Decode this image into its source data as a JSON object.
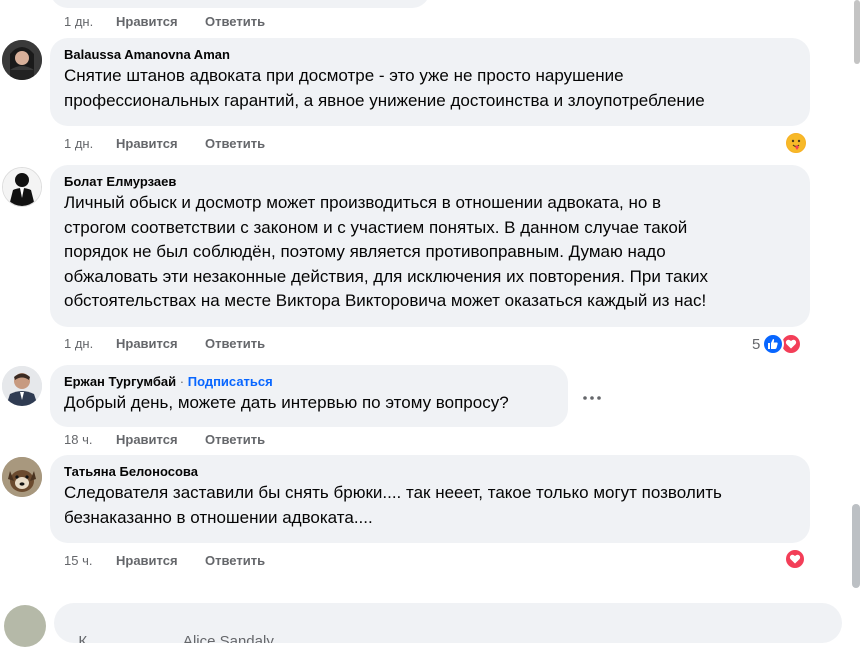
{
  "comments": [
    {
      "author": "Balaussa Amanovna Aman",
      "text": "Снятие штанов адвоката при досмотре - это уже не просто нарушение\nпрофессиональных гарантий, а явное унижение достоинства и злоупотребление",
      "time": "1 дн.",
      "like_label": "Нравится",
      "reply_label": "Ответить",
      "reaction_icons": [
        "care-emoji-icon"
      ]
    },
    {
      "author": "Болат Елмурзаев",
      "text": "Личный обыск и досмотр может производиться в отношении адвоката, но в\nстрогом соответствии с законом и с участием понятых. В данном случае такой\nпорядок не был соблюдён, поэтому является противоправным. Думаю надо\nобжаловать эти незаконные действия, для исключения их повторения. При таких\nобстоятельствах на месте Виктора Викторовича может оказаться каждый из нас!",
      "time": "1 дн.",
      "like_label": "Нравится",
      "reply_label": "Ответить",
      "reaction_count": "5",
      "reaction_icons": [
        "like-reaction-icon",
        "love-reaction-icon"
      ]
    },
    {
      "author": "Ержан Тургумбай",
      "separator": "·",
      "follow_label": "Подписаться",
      "text": "Добрый день, можете дать интервью по этому вопросу?",
      "time": "18 ч.",
      "like_label": "Нравится",
      "reply_label": "Ответить"
    },
    {
      "author": "Татьяна Белоносова",
      "text": "Следователя заставили бы снять брюки.... так нееет, такое только могут позволить\nбезнаказанно в отношении адвоката....",
      "time": "15 ч.",
      "like_label": "Нравится",
      "reply_label": "Ответить",
      "reaction_icons": [
        "love-reaction-icon"
      ]
    }
  ],
  "top_meta": {
    "time": "1 дн.",
    "like_label": "Нравится",
    "reply_label": "Ответить"
  },
  "composer": {
    "placeholder_visible": "К                       Alice Sandaly"
  },
  "colors": {
    "bubble": "#f0f2f5",
    "meta": "#65676b",
    "link": "#0866ff",
    "like": "#0866ff",
    "love": "#f33e58"
  }
}
